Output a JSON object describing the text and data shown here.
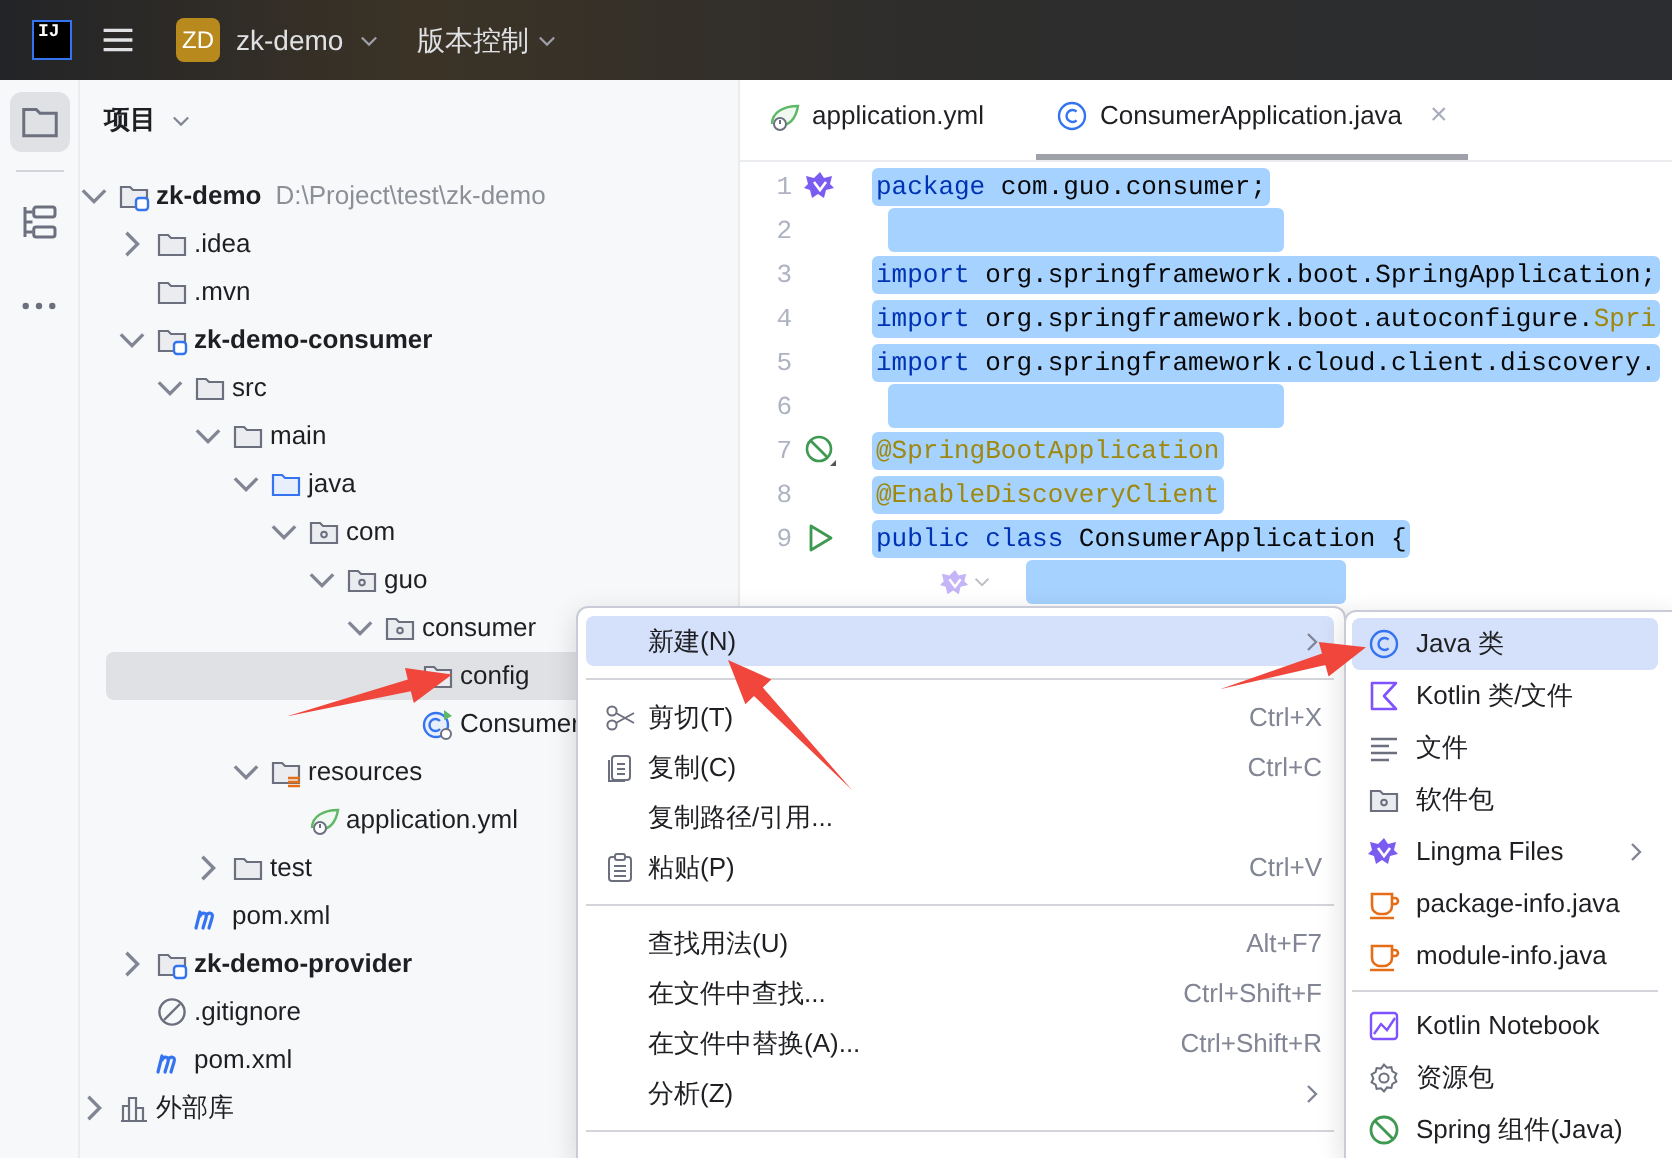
{
  "title_bar": {
    "logo_text": "IJ",
    "project_badge": "ZD",
    "project_name": "zk-demo",
    "vcs_menu": "版本控制"
  },
  "tool_strip": [
    {
      "kind": "project",
      "selected": true
    },
    {
      "kind": "structure",
      "selected": false
    },
    {
      "kind": "more",
      "selected": false
    }
  ],
  "project_panel": {
    "title": "项目",
    "tree": [
      {
        "label": "zk-demo",
        "note": "D:\\Project\\test\\zk-demo",
        "kind": "module",
        "bold": true,
        "expanded": true,
        "selected": false,
        "children": [
          {
            "label": ".idea",
            "kind": "folder",
            "bold": false,
            "expanded": false,
            "selected": false
          },
          {
            "label": ".mvn",
            "kind": "folder",
            "bold": false,
            "selected": false
          },
          {
            "label": "zk-demo-consumer",
            "kind": "module",
            "bold": true,
            "expanded": true,
            "selected": false,
            "children": [
              {
                "label": "src",
                "kind": "folder",
                "bold": false,
                "expanded": true,
                "selected": false,
                "children": [
                  {
                    "label": "main",
                    "kind": "folder",
                    "bold": false,
                    "expanded": true,
                    "selected": false,
                    "children": [
                      {
                        "label": "java",
                        "kind": "source",
                        "bold": false,
                        "expanded": true,
                        "selected": false,
                        "children": [
                          {
                            "label": "com",
                            "kind": "package",
                            "bold": false,
                            "expanded": true,
                            "selected": false,
                            "children": [
                              {
                                "label": "guo",
                                "kind": "package",
                                "bold": false,
                                "expanded": true,
                                "selected": false,
                                "children": [
                                  {
                                    "label": "consumer",
                                    "kind": "package",
                                    "bold": false,
                                    "expanded": true,
                                    "selected": false,
                                    "children": [
                                      {
                                        "label": "config",
                                        "kind": "package",
                                        "bold": false,
                                        "selected": true
                                      },
                                      {
                                        "label": "Consumer",
                                        "kind": "spring-class",
                                        "bold": false,
                                        "selected": false
                                      }
                                    ]
                                  }
                                ]
                              }
                            ]
                          }
                        ]
                      },
                      {
                        "label": "resources",
                        "kind": "resources",
                        "bold": false,
                        "expanded": true,
                        "selected": false,
                        "children": [
                          {
                            "label": "application.yml",
                            "kind": "yaml",
                            "bold": false,
                            "selected": false
                          }
                        ]
                      }
                    ]
                  },
                  {
                    "label": "test",
                    "kind": "folder",
                    "bold": false,
                    "expanded": false,
                    "selected": false
                  }
                ]
              },
              {
                "label": "pom.xml",
                "kind": "maven",
                "bold": false,
                "selected": false
              }
            ]
          },
          {
            "label": "zk-demo-provider",
            "kind": "module",
            "bold": true,
            "expanded": false,
            "selected": false
          },
          {
            "label": ".gitignore",
            "kind": "ignore",
            "bold": false,
            "selected": false
          },
          {
            "label": "pom.xml",
            "kind": "maven",
            "bold": false,
            "selected": false
          }
        ]
      },
      {
        "label": "外部库",
        "kind": "library",
        "bold": false,
        "expanded": false,
        "selected": false
      }
    ]
  },
  "editor_tabs": [
    {
      "label": "application.yml",
      "kind": "yaml",
      "selected": false
    },
    {
      "label": "ConsumerApplication.java",
      "kind": "class",
      "selected": true,
      "close": "×"
    }
  ],
  "code_lines": [
    {
      "kind": "lingma",
      "number": "1",
      "selected": true,
      "tokens": [
        {
          "kind": "keyword",
          "text": "package"
        },
        {
          "kind": "plain",
          "text": " com.guo.consumer;"
        }
      ]
    },
    {
      "kind": "plain",
      "number": "2",
      "selected": true
    },
    {
      "kind": "plain",
      "number": "3",
      "selected": true,
      "tokens": [
        {
          "kind": "keyword",
          "text": "import"
        },
        {
          "kind": "plain",
          "text": " org.springframework.boot.SpringApplication;"
        }
      ]
    },
    {
      "kind": "plain",
      "number": "4",
      "selected": true,
      "tokens": [
        {
          "kind": "keyword",
          "text": "import"
        },
        {
          "kind": "plain",
          "text": " org.springframework.boot.autoconfigure."
        },
        {
          "kind": "annotation",
          "text": "Spri"
        }
      ]
    },
    {
      "kind": "plain",
      "number": "5",
      "selected": true,
      "tokens": [
        {
          "kind": "keyword",
          "text": "import"
        },
        {
          "kind": "plain",
          "text": " org.springframework.cloud.client.discovery."
        }
      ]
    },
    {
      "kind": "plain",
      "number": "6",
      "selected": true
    },
    {
      "kind": "bean",
      "number": "7",
      "selected": true,
      "tokens": [
        {
          "kind": "annotation",
          "text": "@SpringBootApplication"
        }
      ]
    },
    {
      "kind": "plain",
      "number": "8",
      "selected": true,
      "tokens": [
        {
          "kind": "annotation",
          "text": "@EnableDiscoveryClient"
        }
      ]
    },
    {
      "kind": "run",
      "number": "9",
      "selected": true,
      "tokens": [
        {
          "kind": "keyword",
          "text": "public class"
        },
        {
          "kind": "plain",
          "text": " ConsumerApplication {"
        }
      ]
    },
    {
      "kind": "hint",
      "selected": true
    }
  ],
  "context_menu": [
    {
      "kind": "plain",
      "label": "新建(N)",
      "submenu": true,
      "selected": true
    },
    {
      "kind": "separator"
    },
    {
      "kind": "cut",
      "label": "剪切(T)",
      "shortcut": "Ctrl+X",
      "selected": false
    },
    {
      "kind": "copy",
      "label": "复制(C)",
      "shortcut": "Ctrl+C",
      "selected": false
    },
    {
      "kind": "plain",
      "label": "复制路径/引用...",
      "selected": false
    },
    {
      "kind": "paste",
      "label": "粘贴(P)",
      "shortcut": "Ctrl+V",
      "selected": false
    },
    {
      "kind": "separator"
    },
    {
      "kind": "plain",
      "label": "查找用法(U)",
      "shortcut": "Alt+F7",
      "selected": false
    },
    {
      "kind": "plain",
      "label": "在文件中查找...",
      "shortcut": "Ctrl+Shift+F",
      "selected": false
    },
    {
      "kind": "plain",
      "label": "在文件中替换(A)...",
      "shortcut": "Ctrl+Shift+R",
      "selected": false
    },
    {
      "kind": "plain",
      "label": "分析(Z)",
      "submenu": true,
      "selected": false
    },
    {
      "kind": "separator"
    }
  ],
  "new_submenu": [
    {
      "kind": "class",
      "label": "Java 类",
      "selected": true
    },
    {
      "kind": "kotlin",
      "label": "Kotlin 类/文件",
      "selected": false
    },
    {
      "kind": "file",
      "label": "文件",
      "selected": false
    },
    {
      "kind": "package",
      "label": "软件包",
      "selected": false
    },
    {
      "kind": "lingma",
      "label": "Lingma Files",
      "submenu": true,
      "selected": false
    },
    {
      "kind": "java",
      "label": "package-info.java",
      "selected": false
    },
    {
      "kind": "java",
      "label": "module-info.java",
      "selected": false
    },
    {
      "kind": "separator"
    },
    {
      "kind": "notebook",
      "label": "Kotlin Notebook",
      "selected": false
    },
    {
      "kind": "gear",
      "label": "资源包",
      "selected": false
    },
    {
      "kind": "spring",
      "label": "Spring 组件(Java)",
      "selected": false
    }
  ]
}
